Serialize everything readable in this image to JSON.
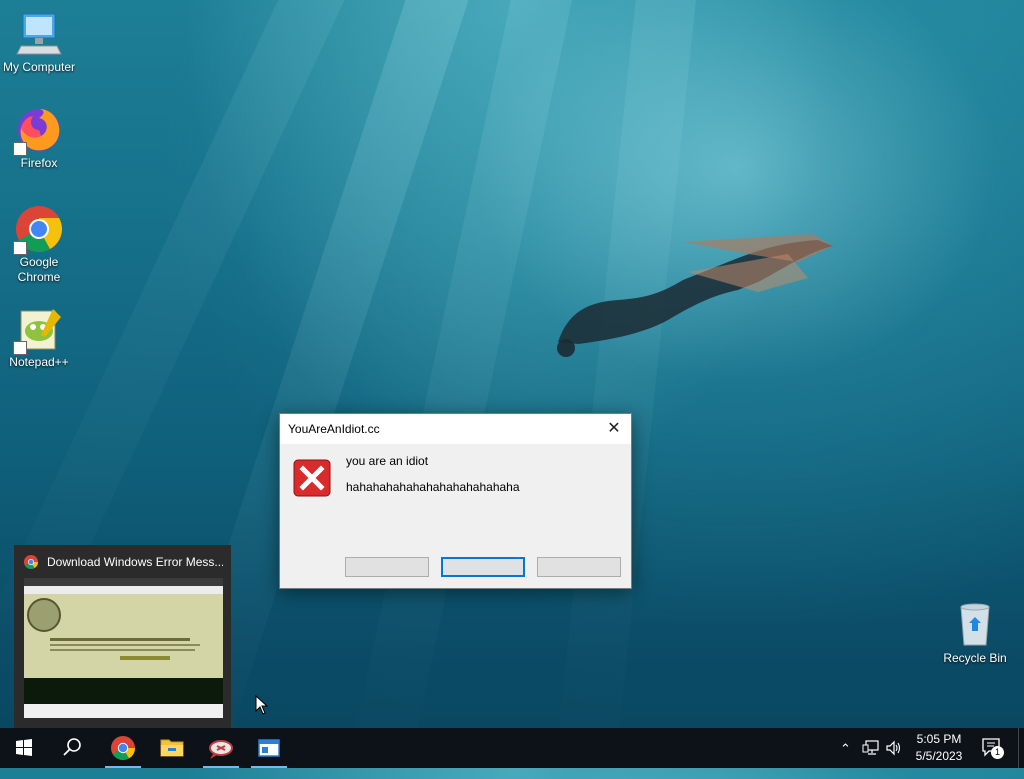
{
  "desktop": {
    "icons": [
      {
        "label": "My Computer"
      },
      {
        "label": "Firefox"
      },
      {
        "label": "Google Chrome"
      },
      {
        "label": "Notepad++"
      },
      {
        "label": "Recycle Bin"
      }
    ]
  },
  "dialog": {
    "title": "YouAreAnIdiot.cc",
    "close_glyph": "✕",
    "message_line1": "you are an idiot",
    "message_line2": "hahahahahahahahahahahahaha",
    "icon": "error-x-icon"
  },
  "taskbar_thumbnail": {
    "title": "Download Windows Error Mess..."
  },
  "taskbar": {
    "items": [
      "start-icon",
      "search-icon",
      "chrome-icon",
      "file-explorer-icon",
      "error-message-creator-icon",
      "window-app-icon"
    ],
    "tray": {
      "chevron": "⌃",
      "notification_count": "1"
    },
    "clock": {
      "time": "5:05 PM",
      "date": "5/5/2023"
    }
  }
}
